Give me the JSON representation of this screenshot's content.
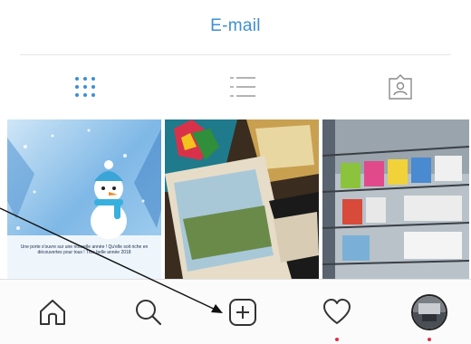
{
  "header": {
    "email_label": "E-mail"
  },
  "view_tabs": {
    "items": [
      {
        "icon": "grid-icon",
        "selected": true
      },
      {
        "icon": "list-icon",
        "selected": false
      },
      {
        "icon": "tagged-icon",
        "selected": false
      }
    ]
  },
  "photos": {
    "items": [
      {
        "subject": "snowman",
        "caption": "Une porte s'ouvre sur une nouvelle année ! Qu'elle soit riche en découvertes pour tous ! Très belle année 2018"
      },
      {
        "subject": "books"
      },
      {
        "subject": "bookshelf"
      }
    ]
  },
  "bottom_nav": {
    "items": [
      {
        "icon": "home-icon"
      },
      {
        "icon": "search-icon"
      },
      {
        "icon": "add-post-icon"
      },
      {
        "icon": "heart-icon",
        "notification": true
      },
      {
        "icon": "profile-avatar",
        "notification": true
      }
    ]
  },
  "colors": {
    "accent": "#3d8fd6",
    "notification": "#e0304a",
    "icon": "#333333"
  }
}
